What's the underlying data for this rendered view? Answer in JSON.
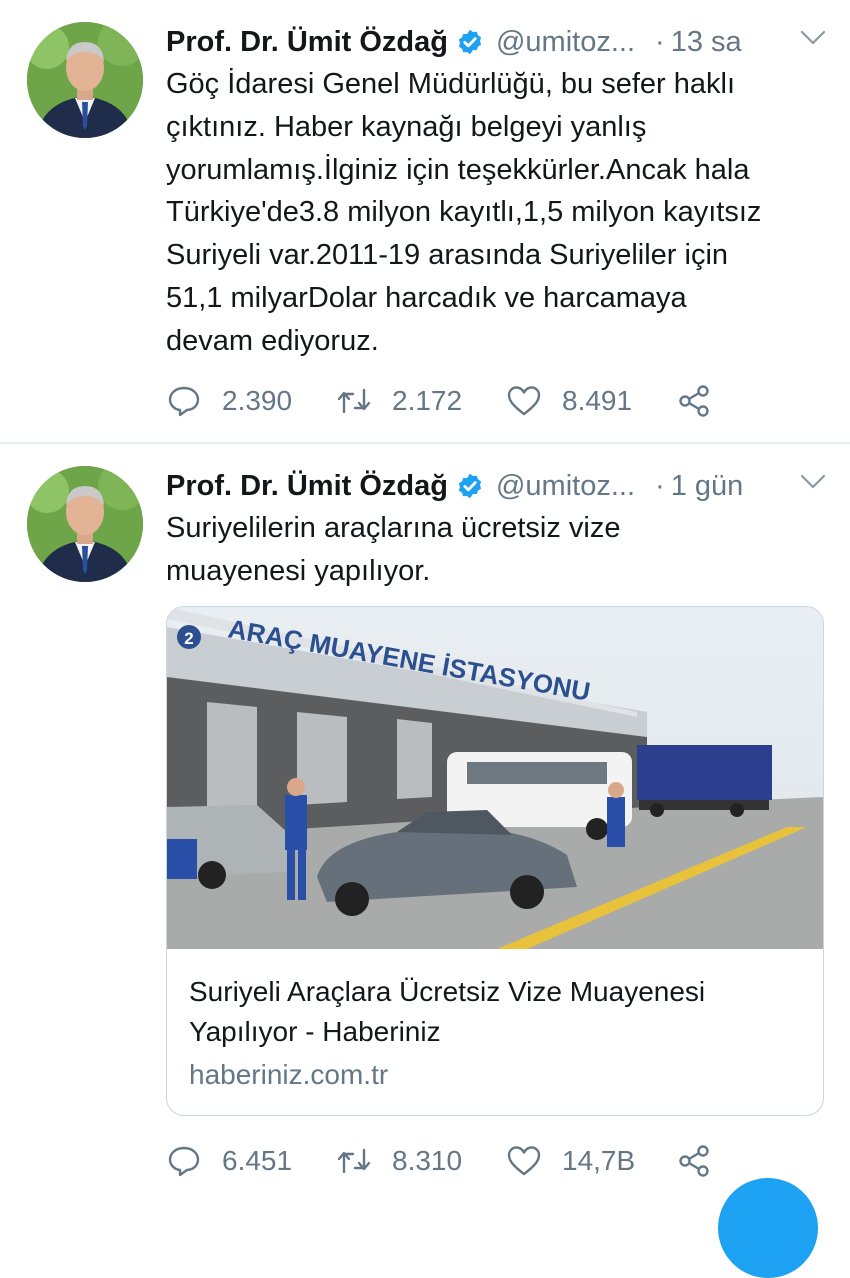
{
  "tweets": [
    {
      "author_name": "Prof. Dr. Ümit Özdağ",
      "handle": "@umitoz...",
      "time_separator": "·",
      "time": "13 sa",
      "text_lines": [
        "Göç İdaresi Genel Müdürlüğü, bu sefer haklı",
        "çıktınız. Haber kaynağı belgeyi yanlış",
        "yorumlamış.İlginiz için teşekkürler.Ancak hala",
        "Türkiye'de3.8 milyon kayıtlı,1,5 milyon kayıtsız",
        "Suriyeli var.2011-19 arasında Suriyeliler için",
        "51,1 milyarDolar harcadık ve harcamaya",
        "devam ediyoruz."
      ],
      "replies": "2.390",
      "retweets": "2.172",
      "likes": "8.491"
    },
    {
      "author_name": "Prof. Dr. Ümit Özdağ",
      "handle": "@umitoz...",
      "time_separator": "·",
      "time": "1 gün",
      "text_lines": [
        "Suriyelilerin araçlarına ücretsiz vize",
        "muayenesi yapılıyor."
      ],
      "card": {
        "title_lines": [
          "Suriyeli Araçlara Ücretsiz Vize Muayenesi",
          "Yapılıyor - Haberiniz"
        ],
        "domain": "haberiniz.com.tr",
        "image_sign_text": "ARAÇ MUAYENE İSTASYONU",
        "image_sign_number": "2"
      },
      "replies": "6.451",
      "retweets": "8.310",
      "likes": "14,7B"
    }
  ],
  "colors": {
    "verified": "#1da1f2",
    "secondary_text": "#657786",
    "divider": "#e6ecf0"
  },
  "icons": [
    "verified-badge-icon",
    "chevron-down-icon",
    "reply-icon",
    "retweet-icon",
    "like-icon",
    "share-icon"
  ]
}
